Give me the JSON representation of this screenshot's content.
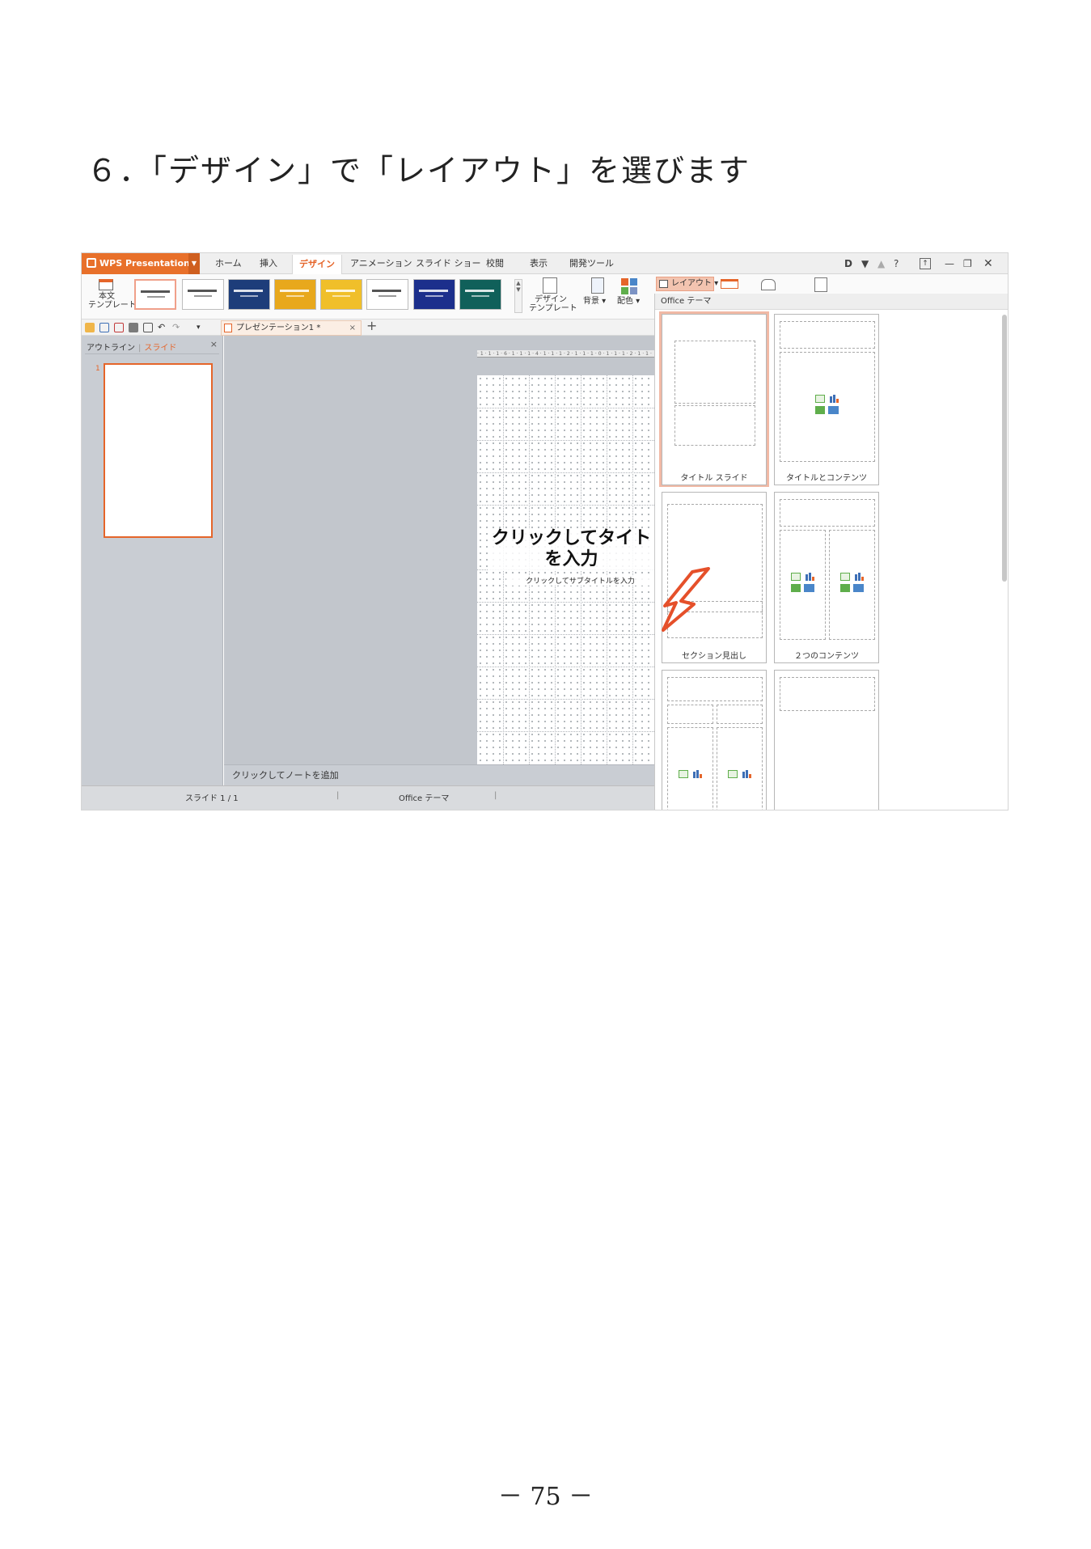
{
  "heading": "６．「デザイン」で「レイアウト」を選びます",
  "page_number": "－ 75 －",
  "app": {
    "name": "WPS Presentation",
    "accent": "#e5652a"
  },
  "menu": {
    "tabs": [
      "ホーム",
      "挿入",
      "デザイン",
      "アニメーション",
      "スライド ショー",
      "校閲",
      "表示",
      "開発ツール"
    ],
    "active_tab": "デザイン",
    "help": "?"
  },
  "ribbon": {
    "body_template_label_1": "本文",
    "body_template_label_2": "テンプレート",
    "design_template_label_1": "デザイン",
    "design_template_label_2": "テンプレート",
    "background_label": "背景",
    "color_scheme_label": "配色",
    "layout_button": "レイアウト",
    "template_colors": [
      "#ffffff",
      "#ffffff",
      "#1d3d7a",
      "#e8a81c",
      "#f0bf2a",
      "#ffffff",
      "#1c2f8c",
      "#10605a"
    ]
  },
  "doc_tab": {
    "title": "プレゼンテーション1 *",
    "close": "×"
  },
  "left_panel": {
    "tab_outline": "アウトライン",
    "tab_slides": "スライド",
    "close": "×",
    "slide_number": "1"
  },
  "slide": {
    "title_placeholder": "クリックしてタイトルを入力",
    "title_line1": "クリックしてタイト",
    "title_line2": "を入力",
    "subtitle_placeholder": "クリックしてサブタイトルを入力"
  },
  "notes_placeholder": "クリックしてノートを追加",
  "status": {
    "slide_counter": "スライド 1 / 1",
    "theme": "Office テーマ"
  },
  "layout_panel": {
    "header": "Office テーマ",
    "selected": "タイトル スライド",
    "layouts": [
      {
        "name": "タイトル スライド"
      },
      {
        "name": "タイトルとコンテンツ"
      },
      {
        "name": "セクション見出し"
      },
      {
        "name": "２つのコンテンツ"
      }
    ]
  }
}
